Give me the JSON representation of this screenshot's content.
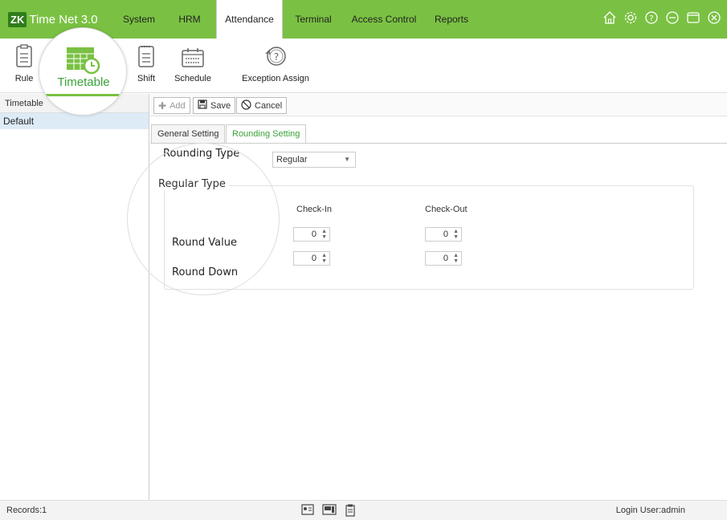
{
  "app": {
    "logo_badge": "ZK",
    "title": "Time Net 3.0"
  },
  "menu": [
    {
      "label": "System"
    },
    {
      "label": "HRM"
    },
    {
      "label": "Attendance"
    },
    {
      "label": "Terminal"
    },
    {
      "label": "Access Control"
    },
    {
      "label": "Reports"
    }
  ],
  "active_menu": "Attendance",
  "window_icons": [
    "home-icon",
    "gear-icon",
    "help-icon",
    "minimize-icon",
    "maximize-icon",
    "close-icon"
  ],
  "ribbon": [
    {
      "label": "Rule",
      "icon": "rule-icon"
    },
    {
      "label": "Timetable",
      "icon": "timetable-icon"
    },
    {
      "label": "Shift",
      "icon": "shift-icon"
    },
    {
      "label": "Schedule",
      "icon": "schedule-icon"
    },
    {
      "label": "Exception Assign",
      "icon": "exception-assign-icon"
    }
  ],
  "left_panel": {
    "header": "Timetable",
    "items": [
      "Default"
    ]
  },
  "toolbar": {
    "add": "Add",
    "save": "Save",
    "cancel": "Cancel"
  },
  "tabs": [
    {
      "label": "General Setting"
    },
    {
      "label": "Rounding Setting"
    }
  ],
  "active_tab": "Rounding Setting",
  "form": {
    "rounding_type_label": "Rounding Type",
    "rounding_type_value": "Regular",
    "regular_type_label": "Regular Type",
    "check_in_header": "Check-In",
    "check_out_header": "Check-Out",
    "round_value_label": "Round Value",
    "round_down_label": "Round Down",
    "round_value_check_in": "0",
    "round_value_check_out": "0",
    "round_down_check_in": "0",
    "round_down_check_out": "0"
  },
  "status": {
    "records": "Records:1",
    "login_user": "Login User:admin"
  },
  "colors": {
    "accent": "#7ac143",
    "selected_row": "#ddebf7",
    "active_tab_text": "#3aa33a"
  }
}
